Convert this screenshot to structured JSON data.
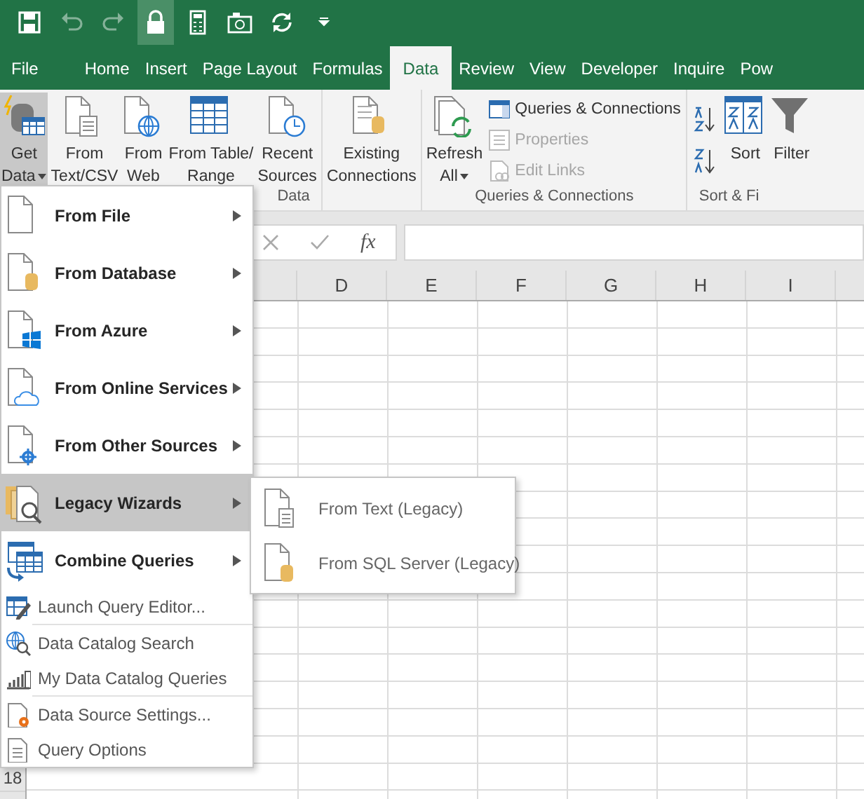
{
  "quick_access": [
    {
      "disabled": false,
      "selected": false
    },
    {
      "disabled": true,
      "selected": false
    },
    {
      "disabled": true,
      "selected": false
    },
    {
      "disabled": false,
      "selected": true
    },
    {
      "disabled": false,
      "selected": false
    },
    {
      "disabled": false,
      "selected": false
    },
    {
      "disabled": false,
      "selected": false
    },
    {
      "disabled": false,
      "selected": false
    }
  ],
  "tabs": [
    {
      "label": "File",
      "selected": false
    },
    {
      "label": "Home",
      "selected": false
    },
    {
      "label": "Insert",
      "selected": false
    },
    {
      "label": "Page Layout",
      "selected": false
    },
    {
      "label": "Formulas",
      "selected": false
    },
    {
      "label": "Data",
      "selected": true
    },
    {
      "label": "Review",
      "selected": false
    },
    {
      "label": "View",
      "selected": false
    },
    {
      "label": "Developer",
      "selected": false
    },
    {
      "label": "Inquire",
      "selected": false
    },
    {
      "label": "Pow",
      "selected": false
    }
  ],
  "ribbon": {
    "groups": [
      {
        "label": "Data",
        "buttons": [
          {
            "lines": [
              "Get",
              "Data"
            ],
            "dropdown": true,
            "selected": true
          },
          {
            "lines": [
              "From",
              "Text/CSV"
            ],
            "dropdown": false,
            "selected": false
          },
          {
            "lines": [
              "From",
              "Web"
            ],
            "dropdown": false,
            "selected": false
          },
          {
            "lines": [
              "From Table/",
              "Range"
            ],
            "dropdown": false,
            "selected": false
          },
          {
            "lines": [
              "Recent",
              "Sources"
            ],
            "dropdown": false,
            "selected": false
          }
        ]
      },
      {
        "buttons": [
          {
            "lines": [
              "Existing",
              "Connections"
            ],
            "dropdown": false,
            "selected": false
          }
        ]
      },
      {
        "label": "Queries & Connections",
        "buttons": [
          {
            "lines": [
              "Refresh",
              "All"
            ],
            "dropdown": true,
            "selected": false
          }
        ],
        "small_buttons": [
          {
            "label": "Queries & Connections",
            "disabled": false
          },
          {
            "label": "Properties",
            "disabled": true
          },
          {
            "label": "Edit Links",
            "disabled": true
          }
        ]
      },
      {
        "label": "Sort & Fi",
        "buttons": [
          {
            "lines": [
              "Sort"
            ],
            "dropdown": false,
            "selected": false
          },
          {
            "lines": [
              "Filter"
            ],
            "dropdown": false,
            "selected": false
          }
        ]
      }
    ]
  },
  "formula_bar": {
    "function_label": "fx"
  },
  "sheet": {
    "column_headers": [
      "D",
      "E",
      "F",
      "G",
      "H",
      "I"
    ],
    "row_headers": [
      "18"
    ]
  },
  "menu": {
    "items": [
      {
        "kind": "large",
        "label": "From File",
        "submenu": true,
        "selected": false
      },
      {
        "kind": "large",
        "label": "From Database",
        "submenu": true,
        "selected": false
      },
      {
        "kind": "large",
        "label": "From Azure",
        "submenu": true,
        "selected": false
      },
      {
        "kind": "large",
        "label": "From Online Services",
        "submenu": true,
        "selected": false
      },
      {
        "kind": "large",
        "label": "From Other Sources",
        "submenu": true,
        "selected": false
      },
      {
        "kind": "large",
        "label": "Legacy Wizards",
        "submenu": true,
        "selected": true
      },
      {
        "kind": "large",
        "label": "Combine Queries",
        "submenu": true,
        "selected": false
      },
      {
        "kind": "small",
        "label": "Launch Query Editor...",
        "submenu": false,
        "selected": false
      },
      {
        "kind": "separator"
      },
      {
        "kind": "small",
        "label": "Data Catalog Search",
        "submenu": false,
        "selected": false
      },
      {
        "kind": "small",
        "label": "My Data Catalog Queries",
        "submenu": false,
        "selected": false
      },
      {
        "kind": "separator"
      },
      {
        "kind": "small",
        "label": "Data Source Settings...",
        "submenu": false,
        "selected": false
      },
      {
        "kind": "small",
        "label": "Query Options",
        "submenu": false,
        "selected": false
      }
    ]
  },
  "submenu": {
    "items": [
      {
        "label": "From Text (Legacy)"
      },
      {
        "label": "From SQL Server (Legacy)"
      }
    ]
  }
}
